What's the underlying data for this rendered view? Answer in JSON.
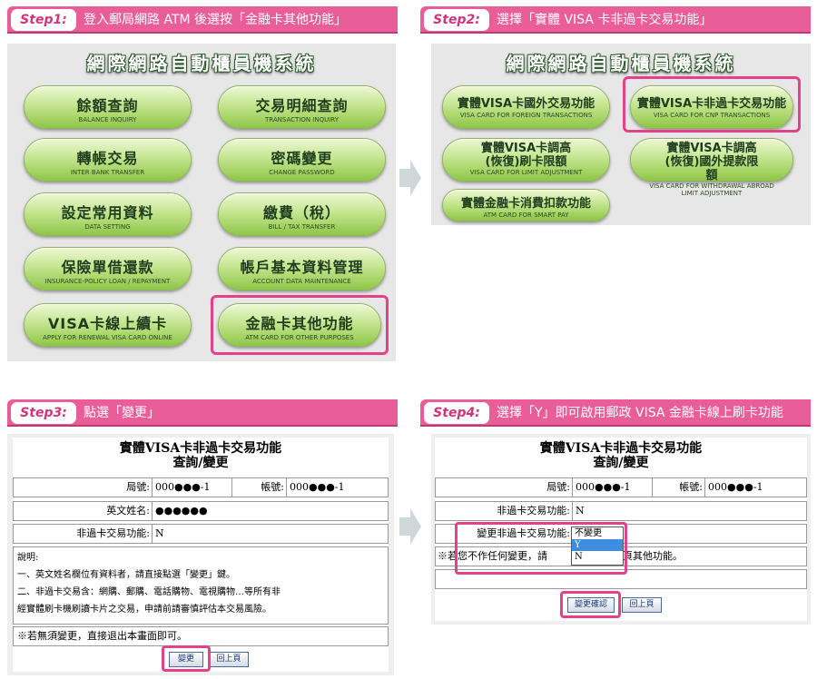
{
  "step1": {
    "tag": "Step1:",
    "title": "登入郵局網路 ATM 後選按「金融卡其他功能」",
    "sys_title": "網際網路自動櫃員機系統",
    "buttons": [
      {
        "zh": "餘額查詢",
        "en": "BALANCE INQUIRY"
      },
      {
        "zh": "交易明細查詢",
        "en": "TRANSACTION INQUIRY"
      },
      {
        "zh": "轉帳交易",
        "en": "INTER BANK TRANSFER"
      },
      {
        "zh": "密碼變更",
        "en": "CHANGE PASSWORD"
      },
      {
        "zh": "設定常用資料",
        "en": "DATA SETTING"
      },
      {
        "zh": "繳費（稅）",
        "en": "BILL / TAX TRANSFER"
      },
      {
        "zh": "保險單借還款",
        "en": "INSURANCE-POLICY LOAN / REPAYMENT"
      },
      {
        "zh": "帳戶基本資料管理",
        "en": "ACCOUNT DATA MAINTENANCE"
      },
      {
        "zh": "VISA卡線上續卡",
        "en": "APPLY FOR RENEWAL VISA CARD ONLINE"
      },
      {
        "zh": "金融卡其他功能",
        "en": "ATM CARD FOR OTHER PURPOSES"
      }
    ]
  },
  "step2": {
    "tag": "Step2:",
    "title": "選擇「實體 VISA 卡非過卡交易功能」",
    "sys_title": "網際網路自動櫃員機系統",
    "buttons": [
      {
        "zh": "實體VISA卡國外交易功能",
        "en": "VISA CARD FOR FOREIGN TRANSACTIONS"
      },
      {
        "zh": "實體VISA卡非過卡交易功能",
        "en": "VISA CARD FOR CNP TRANSACTIONS"
      },
      {
        "zh": "實體VISA卡調高(恢復)刷卡限額",
        "en": "VISA CARD FOR LIMIT ADJUSTMENT"
      },
      {
        "zh": "實體VISA卡調高(恢復)國外提款限額",
        "en": "VISA CARD FOR WITHDRAWAL ABROAD LIMIT ADJUSTMENT"
      },
      {
        "zh": "實體金融卡消費扣款功能",
        "en": "ATM CARD FOR SMART PAY"
      }
    ]
  },
  "step3": {
    "tag": "Step3:",
    "title": "點選「變更」",
    "form_title_1": "實體VISA卡非過卡交易功能",
    "form_title_2": "查詢/變更",
    "branch_label": "局號:",
    "branch_value": "000●●●-1",
    "account_label": "帳號:",
    "account_value": "000●●●-1",
    "name_label": "英文姓名:",
    "name_value": "●●●●●●",
    "cnp_label": "非過卡交易功能:",
    "cnp_value": "N",
    "note_1": "說明:",
    "note_2": "一、英文姓名欄位有資料者，請直接點選「變更」鍵。",
    "note_3": "二、非過卡交易含：網購、郵購、電話購物、電視購物…等所有非",
    "note_4": "經實體刷卡機刷讀卡片之交易，申請前請審慎評估本交易風險。",
    "exit_note": "※若無須變更，直接退出本畫面即可。",
    "change_button": "變更",
    "back_button": "回上頁"
  },
  "step4": {
    "tag": "Step4:",
    "title": "選擇「Y」即可啟用郵政 VISA 金融卡線上刷卡功能",
    "form_title_1": "實體VISA卡非過卡交易功能",
    "form_title_2": "查詢/變更",
    "branch_label": "局號:",
    "branch_value": "000●●●-1",
    "account_label": "帳號:",
    "account_value": "000●●●-1",
    "cnp_label": "非過卡交易功能:",
    "cnp_value": "N",
    "change_label": "變更非過卡交易功能:",
    "options": [
      "不變更",
      "Y",
      "N"
    ],
    "note_a": "※若您不作任何變更，請",
    "note_b": "頁其他功能。",
    "confirm_button": "變更確認",
    "back_button": "回上頁"
  }
}
